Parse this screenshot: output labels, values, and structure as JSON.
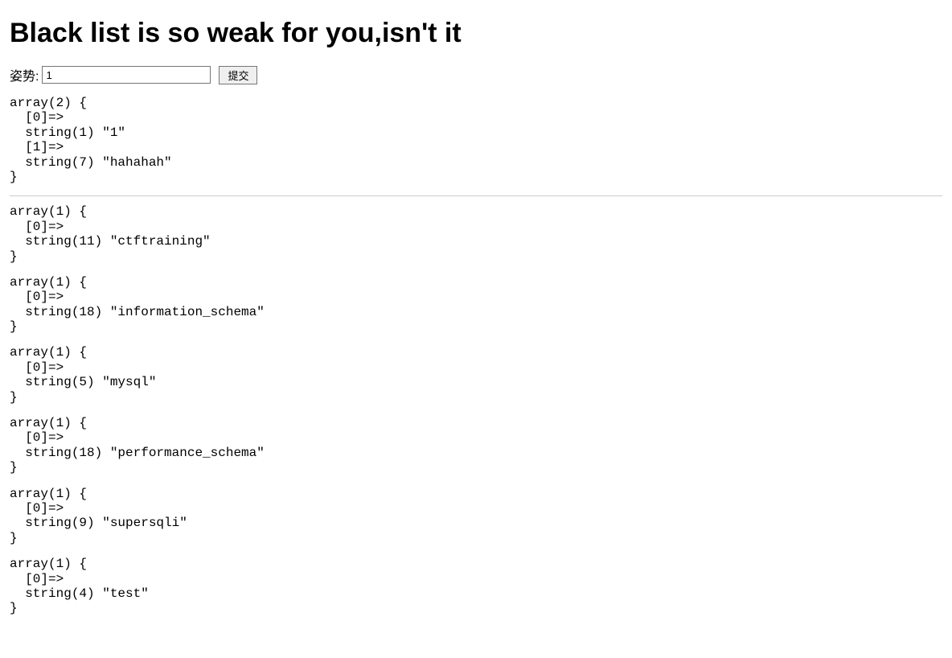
{
  "title": "Black list is so weak for you,isn't it",
  "form": {
    "label": "姿势:",
    "input_value": "1",
    "submit_label": "提交"
  },
  "dumps_before_hr": [
    "array(2) {\n  [0]=>\n  string(1) \"1\"\n  [1]=>\n  string(7) \"hahahah\"\n}"
  ],
  "dumps_after_hr": [
    "array(1) {\n  [0]=>\n  string(11) \"ctftraining\"\n}",
    "array(1) {\n  [0]=>\n  string(18) \"information_schema\"\n}",
    "array(1) {\n  [0]=>\n  string(5) \"mysql\"\n}",
    "array(1) {\n  [0]=>\n  string(18) \"performance_schema\"\n}",
    "array(1) {\n  [0]=>\n  string(9) \"supersqli\"\n}",
    "array(1) {\n  [0]=>\n  string(4) \"test\"\n}"
  ]
}
